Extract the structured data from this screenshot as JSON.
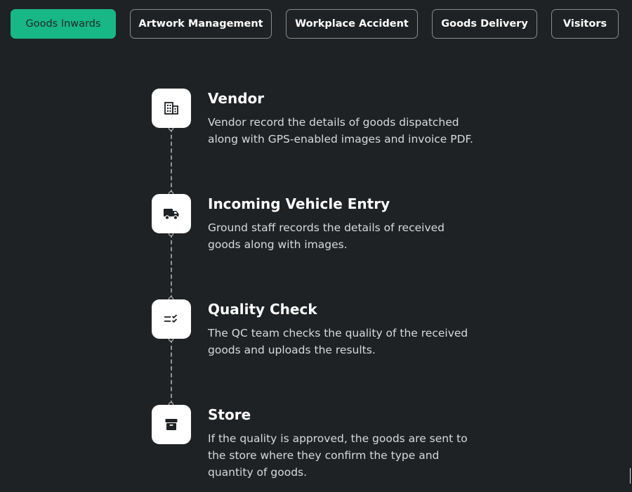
{
  "tabs": [
    {
      "label": "Goods Inwards",
      "active": true
    },
    {
      "label": "Artwork Management",
      "active": false
    },
    {
      "label": "Workplace Accident",
      "active": false
    },
    {
      "label": "Goods Delivery",
      "active": false
    },
    {
      "label": "Visitors",
      "active": false
    }
  ],
  "steps": [
    {
      "icon": "building-icon",
      "title": "Vendor",
      "description": "Vendor record the details of goods dispatched along with GPS-enabled images and invoice PDF."
    },
    {
      "icon": "truck-icon",
      "title": "Incoming Vehicle Entry",
      "description": "Ground staff records the details of received goods along with images."
    },
    {
      "icon": "checklist-icon",
      "title": "Quality Check",
      "description": "The QC team checks the quality of the received goods and uploads the results."
    },
    {
      "icon": "archive-box-icon",
      "title": "Store",
      "description": "If the quality is approved, the goods are sent to the store where they confirm the type and quantity of goods."
    }
  ],
  "colors": {
    "background": "#1f2224",
    "accent": "#18b886",
    "tab_border": "#8a8d90",
    "text_primary": "#ffffff",
    "text_secondary": "#d8dadb"
  }
}
